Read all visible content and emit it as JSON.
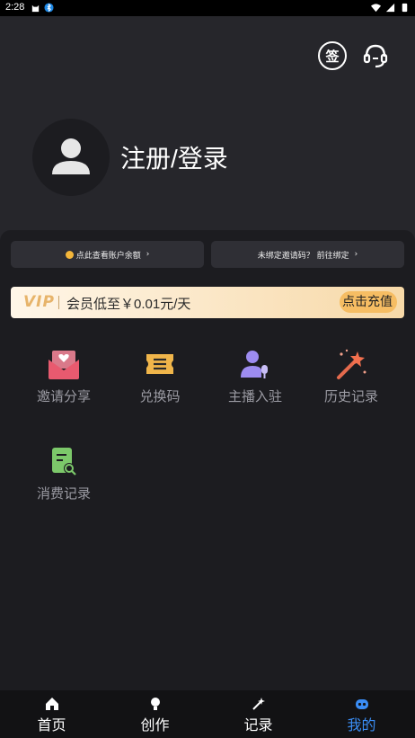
{
  "status_bar": {
    "time": "2:28"
  },
  "header": {
    "sign_label": "签",
    "login_label": "注册/登录"
  },
  "account": {
    "balance_label": "点此查看账户余额",
    "invite_label": "未绑定邀请码？ 前往绑定"
  },
  "vip": {
    "logo": "VIP",
    "text": "会员低至￥0.01元/天",
    "button_label": "点击充值"
  },
  "grid": [
    {
      "label": "邀请分享",
      "icon": "envelope-heart-icon"
    },
    {
      "label": "兑换码",
      "icon": "ticket-icon"
    },
    {
      "label": "主播入驻",
      "icon": "anchor-microphone-icon"
    },
    {
      "label": "历史记录",
      "icon": "magic-wand-icon"
    },
    {
      "label": "消费记录",
      "icon": "receipt-search-icon"
    }
  ],
  "nav": [
    {
      "label": "首页",
      "icon": "home-icon"
    },
    {
      "label": "创作",
      "icon": "lightbulb-icon"
    },
    {
      "label": "记录",
      "icon": "wand-icon"
    },
    {
      "label": "我的",
      "icon": "robot-face-icon",
      "active": true
    }
  ],
  "colors": {
    "accent": "#3a8df5",
    "vip_gold": "#f6bd63",
    "background": "#1c1c20"
  }
}
